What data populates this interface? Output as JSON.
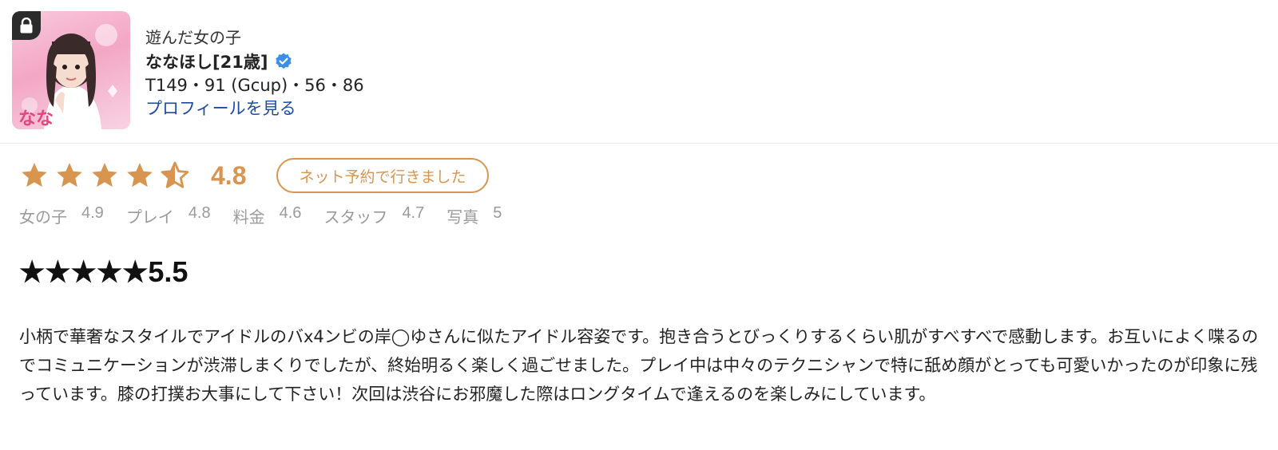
{
  "header": {
    "caption": "遊んだ女の子",
    "name": "ななほし[21歳]",
    "stats": "T149・91 (Gcup)・56・86",
    "profile_link": "プロフィールを見る"
  },
  "rating": {
    "stars_filled": 4.5,
    "overall": "4.8",
    "badge": "ネット予約で行きました",
    "accent_color": "#d89550"
  },
  "sub_ratings": [
    {
      "label": "女の子",
      "value": "4.9"
    },
    {
      "label": "プレイ",
      "value": "4.8"
    },
    {
      "label": "料金",
      "value": "4.6"
    },
    {
      "label": "スタッフ",
      "value": "4.7"
    },
    {
      "label": "写真",
      "value": "5"
    }
  ],
  "review": {
    "title": "★★★★★5.5",
    "body": "小柄で華奢なスタイルでアイドルのバx4ンビの岸◯ゆさんに似たアイドル容姿です。抱き合うとびっくりするくらい肌がすべすべで感動します。お互いによく喋るのでコミュニケーションが渋滞しまくりでしたが、終始明るく楽しく過ごせました。プレイ中は中々のテクニシャンで特に舐め顔がとっても可愛いかったのが印象に残っています。膝の打撲お大事にして下さい！次回は渋谷にお邪魔した際はロングタイムで逢えるのを楽しみにしています。"
  },
  "icons": {
    "lock": "lock-icon",
    "verified": "verified-check-icon",
    "star": "star-icon"
  }
}
